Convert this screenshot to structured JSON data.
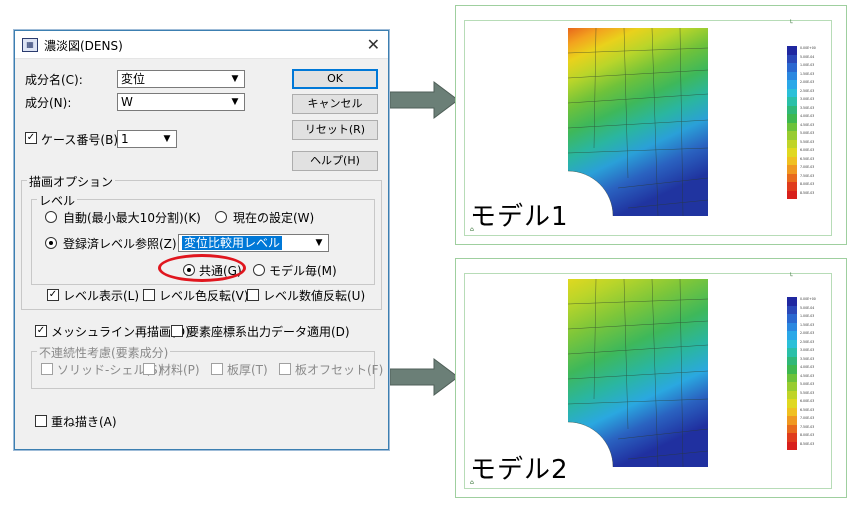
{
  "dialog": {
    "title": "濃淡図(DENS)",
    "component_name_label": "成分名(C):",
    "component_name_value": "変位",
    "component_label": "成分(N):",
    "component_value": "W",
    "case_number_label": "ケース番号(B):",
    "case_number_value": "1",
    "buttons": {
      "ok": "OK",
      "cancel": "キャンセル",
      "reset": "リセット(R)",
      "help": "ヘルプ(H)"
    },
    "draw_options_label": "描画オプション",
    "level_group_label": "レベル",
    "auto_label": "自動(最小最大10分割)(K)",
    "current_label": "現在の設定(W)",
    "registered_label": "登録済レベル参照(Z)",
    "registered_value": "変位比較用レベル",
    "common_label": "共通(G)",
    "per_model_label": "モデル毎(M)",
    "level_display_label": "レベル表示(L)",
    "level_color_invert_label": "レベル色反転(V)",
    "level_value_invert_label": "レベル数値反転(U)",
    "mesh_redraw_label": "メッシュライン再描画(O)",
    "element_coord_label": "要素座標系出力データ適用(D)",
    "discontinuity_label": "不連続性考慮(要素成分)",
    "solid_shell_label": "ソリッド-シェル(S)",
    "material_label": "材料(P)",
    "thickness_label": "板厚(T)",
    "plate_offset_label": "板オフセット(F)",
    "overlay_label": "重ね描き(A)"
  },
  "panels": {
    "model1": "モデル1",
    "model2": "モデル2",
    "legend_values": [
      "0.00E+00",
      "5.00E-04",
      "1.00E-03",
      "1.50E-03",
      "2.00E-03",
      "2.50E-03",
      "3.00E-03",
      "3.50E-03",
      "4.00E-03",
      "4.50E-03",
      "5.00E-03",
      "5.50E-03",
      "6.00E-03",
      "6.50E-03",
      "7.00E-03",
      "7.50E-03",
      "8.00E-03",
      "8.50E-03",
      "9.00E-03",
      "1.00E-02"
    ]
  },
  "colors": {
    "dialog_bg": "#f0f0f0",
    "accent": "#0078d7",
    "highlight_ring": "#e0161e",
    "arrow": "#6b7f77",
    "panel_border": "#9fcf9f"
  }
}
